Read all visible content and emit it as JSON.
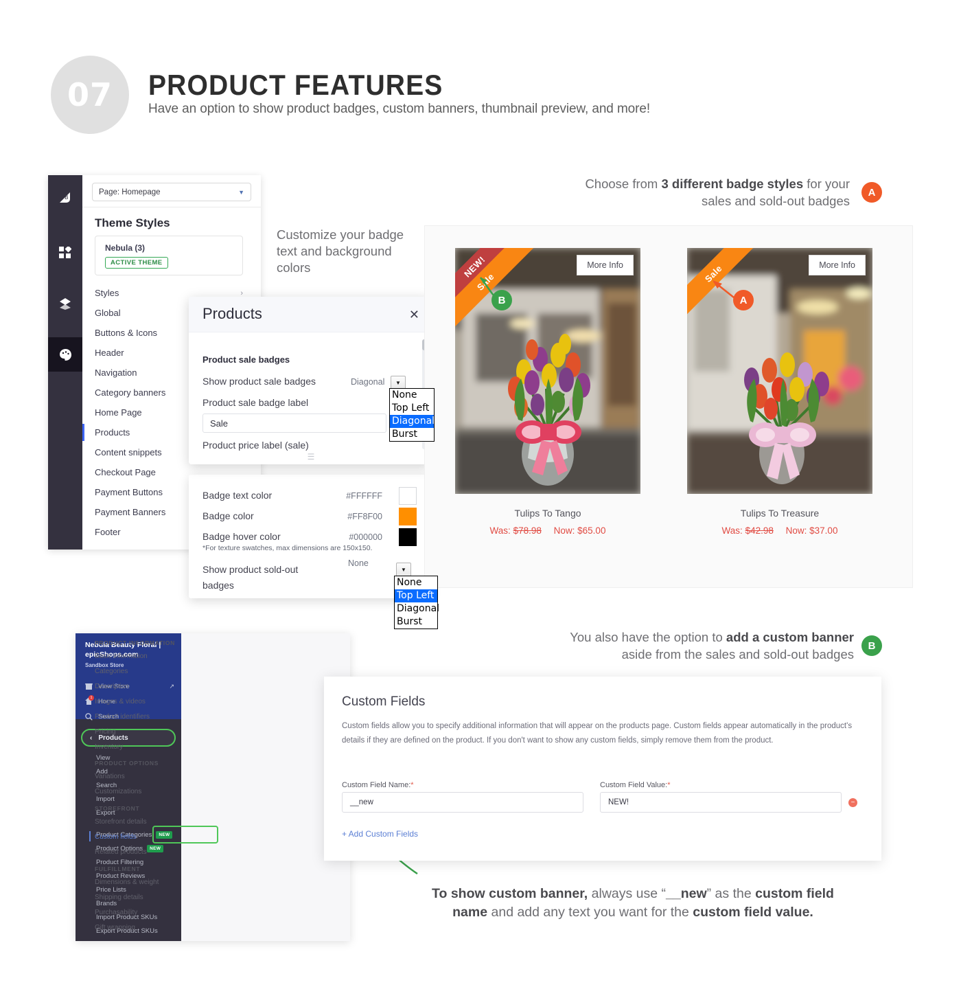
{
  "header": {
    "number": "07",
    "title": "PRODUCT FEATURES",
    "subtitle": "Have an option to show product badges, custom banners, thumbnail preview, and more!"
  },
  "theme_panel": {
    "page_select": "Page: Homepage",
    "caret": "▼",
    "heading": "Theme Styles",
    "theme_name": "Nebula (3)",
    "theme_badge": "ACTIVE THEME",
    "nav": [
      {
        "label": "Styles",
        "chevron": "›"
      },
      {
        "label": "Global"
      },
      {
        "label": "Buttons & Icons"
      },
      {
        "label": "Header"
      },
      {
        "label": "Navigation"
      },
      {
        "label": "Category banners"
      },
      {
        "label": "Home Page"
      },
      {
        "label": "Products"
      },
      {
        "label": "Content snippets"
      },
      {
        "label": "Checkout Page"
      },
      {
        "label": "Payment Buttons"
      },
      {
        "label": "Payment Banners"
      },
      {
        "label": "Footer"
      }
    ]
  },
  "products_modal": {
    "title": "Products",
    "close": "✕",
    "section": "Product sale badges",
    "row_show_sale": "Show product sale badges",
    "value_show_sale": "Diagonal",
    "row_badge_label": "Product sale badge label",
    "input_badge_label": "Sale",
    "row_price_label": "Product price label (sale)",
    "dropdown_options": [
      "None",
      "Top Left",
      "Diagonal",
      "Burst"
    ],
    "dropdown_selected": "Diagonal"
  },
  "colors_panel": {
    "rows": [
      {
        "label": "Badge text color",
        "hex": "#FFFFFF",
        "swatch": "#FFFFFF"
      },
      {
        "label": "Badge color",
        "hex": "#FF8F00",
        "swatch": "#FF8F00"
      },
      {
        "label": "Badge hover color",
        "hex": "#000000",
        "swatch": "#000000"
      }
    ],
    "note": "*For texture swatches, max dimensions are 150x150.",
    "soldout_label": "Show product sold-out badges",
    "soldout_value": "None",
    "soldout_options": [
      "None",
      "Top Left",
      "Diagonal",
      "Burst"
    ],
    "soldout_selected": "Top Left"
  },
  "preview": {
    "more_info": "More Info",
    "products": [
      {
        "name": "Tulips To Tango",
        "was_label": "Was:",
        "was_price": "$78.98",
        "now_label": "Now:",
        "now_price": "$65.00",
        "ribbons": [
          {
            "text": "NEW!",
            "color": "#BF3F3F"
          },
          {
            "text": "Sale",
            "color": "#F98613"
          }
        ]
      },
      {
        "name": "Tulips To Treasure",
        "was_label": "Was:",
        "was_price": "$42.98",
        "now_label": "Now:",
        "now_price": "$37.00",
        "ribbons": [
          {
            "text": "Sale",
            "color": "#F98613"
          }
        ]
      }
    ]
  },
  "callouts": {
    "a_top": {
      "line1_pre": "Choose from ",
      "line1_bold": "3 different badge styles",
      "line1_post": " for your",
      "line2": "sales and sold-out badges",
      "letter": "A"
    },
    "customize": "Customize your badge text and background colors",
    "b_mid": {
      "line1_pre": "You also have the option to ",
      "line1_bold": "add a custom banner",
      "line2": "aside from the sales and sold-out badges",
      "letter": "B"
    },
    "bottom": {
      "l1_b1": "To show custom banner,",
      "l1_n1": " always use “",
      "l1_b2": "__new",
      "l1_n2": "” as the ",
      "l1_b3": "custom field",
      "l2_b1": "name",
      "l2_n1": " and add any text you want for the ",
      "l2_b2": "custom field value."
    }
  },
  "bigcommerce": {
    "store_name": "Nebula Beauty Floral | epicShops.com",
    "store_sub": "Sandbox Store",
    "top_items": [
      {
        "icon": "store-icon",
        "label": "View Store",
        "ext": "↗"
      },
      {
        "icon": "home-icon",
        "label": "Home",
        "notification": "1"
      },
      {
        "icon": "search-icon",
        "label": "Search"
      }
    ],
    "products_label": "Products",
    "products_back": "‹",
    "sub_items": [
      "View",
      "Add",
      "Search",
      "Import",
      "Export"
    ],
    "sub_items2": [
      {
        "label": "Product Categories",
        "badge": "NEW"
      },
      {
        "label": "Product Options",
        "badge": "NEW"
      },
      {
        "label": "Product Filtering"
      },
      {
        "label": "Product Reviews"
      },
      {
        "label": "Price Lists"
      },
      {
        "label": "Brands"
      },
      {
        "label": "Import Product SKUs"
      },
      {
        "label": "Export Product SKUs"
      }
    ],
    "product_info_groups": [
      {
        "heading": "PRODUCT INFORMATION",
        "items": [
          "Basic information",
          "Categories",
          "Description",
          "Images & videos",
          "Product identifiers",
          "Pricing",
          "Inventory"
        ]
      },
      {
        "heading": "PRODUCT OPTIONS",
        "items": [
          "Variations",
          "Customizations"
        ]
      },
      {
        "heading": "STOREFRONT",
        "items": [
          "Storefront details",
          "Custom fields",
          "Related products"
        ]
      },
      {
        "heading": "FULFILLMENT",
        "items": [
          "Dimensions & weight",
          "Shipping details",
          "Purchasability",
          "Gift wrapping"
        ]
      }
    ],
    "selected_item": "Custom fields"
  },
  "custom_fields": {
    "title": "Custom Fields",
    "description": "Custom fields allow you to specify additional information that will appear on the products page. Custom fields appear automatically in the product's details if they are defined on the product. If you don't want to show any custom fields, simply remove them from the product.",
    "name_label": "Custom Field Name:",
    "name_value": "__new",
    "value_label": "Custom Field Value:",
    "value_value": "NEW!",
    "required_mark": "*",
    "add_link": "+ Add Custom Fields",
    "remove_icon": "−"
  }
}
